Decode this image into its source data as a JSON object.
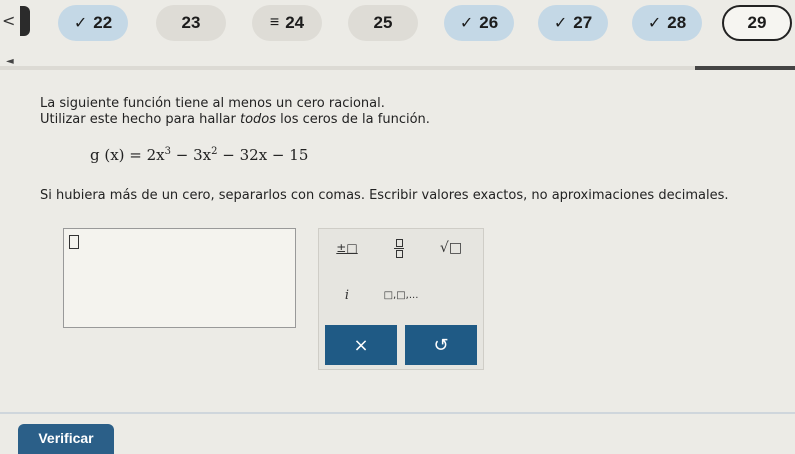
{
  "nav": {
    "prev_glyph": "<",
    "scroll_left_glyph": "◄",
    "questions": [
      {
        "label": "22",
        "mark": "✓",
        "state": "done"
      },
      {
        "label": "23",
        "mark": "",
        "state": "plain"
      },
      {
        "label": "24",
        "mark": "≡",
        "state": "plain"
      },
      {
        "label": "25",
        "mark": "",
        "state": "plain"
      },
      {
        "label": "26",
        "mark": "✓",
        "state": "done"
      },
      {
        "label": "27",
        "mark": "✓",
        "state": "done"
      },
      {
        "label": "28",
        "mark": "✓",
        "state": "done"
      },
      {
        "label": "29",
        "mark": "",
        "state": "current"
      }
    ]
  },
  "problem": {
    "line1": "La siguiente función tiene al menos un cero racional.",
    "line2_pre": "Utilizar este hecho para hallar ",
    "line2_em": "todos",
    "line2_post": " los ceros de la función.",
    "function_lhs": "g (x) = 2x",
    "exp1": "3",
    "term2": " − 3x",
    "exp2": "2",
    "term3": " − 32x − 15",
    "instructions": "Si hubiera más de un cero, separarlos con comas. Escribir valores exactos, no aproximaciones decimales."
  },
  "keypad": {
    "plusminus": "±□",
    "sqrt": "√□",
    "imag": "i",
    "list": "□,□,...",
    "clear": "×",
    "undo": "↺"
  },
  "footer": {
    "verify_label": "Verificar"
  }
}
